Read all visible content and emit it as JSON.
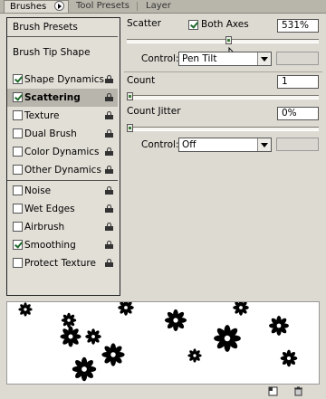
{
  "tabs": [
    {
      "label": "Brushes"
    },
    {
      "label": "Tool Presets"
    },
    {
      "label": "Layer Comps"
    }
  ],
  "sidebar": {
    "presets_label": "Brush Presets",
    "tip_shape_label": "Brush Tip Shape",
    "items": [
      {
        "label": "Shape Dynamics",
        "checked": true,
        "locked": true,
        "selected": false
      },
      {
        "label": "Scattering",
        "checked": true,
        "locked": true,
        "selected": true
      },
      {
        "label": "Texture",
        "checked": false,
        "locked": true,
        "selected": false
      },
      {
        "label": "Dual Brush",
        "checked": false,
        "locked": true,
        "selected": false
      },
      {
        "label": "Color Dynamics",
        "checked": false,
        "locked": true,
        "selected": false
      },
      {
        "label": "Other Dynamics",
        "checked": false,
        "locked": true,
        "selected": false
      },
      {
        "label": "Noise",
        "checked": false,
        "locked": true,
        "selected": false
      },
      {
        "label": "Wet Edges",
        "checked": false,
        "locked": true,
        "selected": false
      },
      {
        "label": "Airbrush",
        "checked": false,
        "locked": true,
        "selected": false
      },
      {
        "label": "Smoothing",
        "checked": true,
        "locked": true,
        "selected": false
      },
      {
        "label": "Protect Texture",
        "checked": false,
        "locked": true,
        "selected": false
      }
    ]
  },
  "scatter": {
    "label": "Scatter",
    "both_axes_label": "Both Axes",
    "both_axes_checked": true,
    "value": "531%",
    "slider_fraction": 0.53,
    "control_label": "Control:",
    "control_value": "Pen Tilt"
  },
  "count": {
    "label": "Count",
    "value": "1",
    "slider_fraction": 0.0
  },
  "count_jitter": {
    "label": "Count Jitter",
    "value": "0%",
    "slider_fraction": 0.0,
    "control_label": "Control:",
    "control_value": "Off"
  },
  "colors": {
    "checkmark": "#1e6b2a",
    "selected_row": "#b8b5ac",
    "panel_bg": "#dddad2"
  },
  "icons": [
    "menu-arrow-icon",
    "checkbox-icon",
    "lock-icon",
    "dropdown-arrow-icon",
    "mouse-cursor-icon",
    "new-brush-icon",
    "trash-icon",
    "flower-brush-stroke"
  ]
}
